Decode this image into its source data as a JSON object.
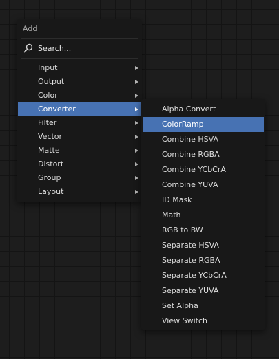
{
  "add_menu": {
    "title": "Add",
    "search_label": "Search...",
    "search_icon": "search-icon",
    "categories": [
      {
        "label": "Input",
        "has_submenu": true
      },
      {
        "label": "Output",
        "has_submenu": true
      },
      {
        "label": "Color",
        "has_submenu": true
      },
      {
        "label": "Converter",
        "has_submenu": true,
        "active": true
      },
      {
        "label": "Filter",
        "has_submenu": true
      },
      {
        "label": "Vector",
        "has_submenu": true
      },
      {
        "label": "Matte",
        "has_submenu": true
      },
      {
        "label": "Distort",
        "has_submenu": true
      },
      {
        "label": "Group",
        "has_submenu": true
      },
      {
        "label": "Layout",
        "has_submenu": true
      }
    ]
  },
  "converter_menu": {
    "items": [
      {
        "label": "Alpha Convert"
      },
      {
        "label": "ColorRamp",
        "active": true
      },
      {
        "label": "Combine HSVA"
      },
      {
        "label": "Combine RGBA"
      },
      {
        "label": "Combine YCbCrA"
      },
      {
        "label": "Combine YUVA"
      },
      {
        "label": "ID Mask"
      },
      {
        "label": "Math"
      },
      {
        "label": "RGB to BW"
      },
      {
        "label": "Separate HSVA"
      },
      {
        "label": "Separate RGBA"
      },
      {
        "label": "Separate YCbCrA"
      },
      {
        "label": "Separate YUVA"
      },
      {
        "label": "Set Alpha"
      },
      {
        "label": "View Switch"
      }
    ]
  },
  "colors": {
    "background": "#1d1d1d",
    "menu_bg": "#181818",
    "highlight": "#4772b3",
    "text": "#dcdcdc"
  }
}
